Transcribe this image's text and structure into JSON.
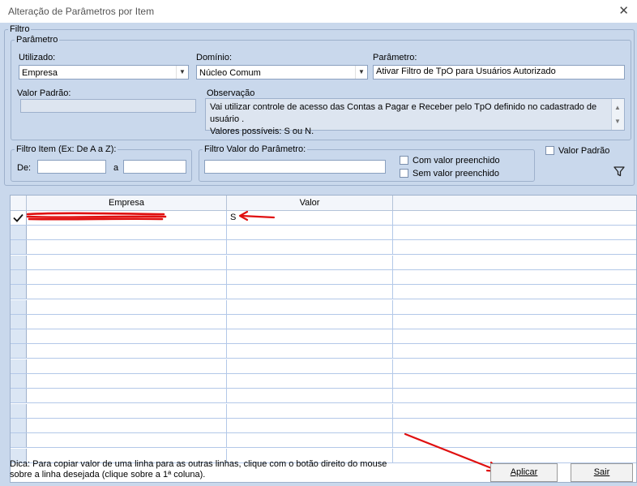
{
  "window": {
    "title": "Alteração de Parâmetros por Item"
  },
  "filtro": {
    "legend": "Filtro",
    "parametro_group": {
      "legend": "Parâmetro",
      "utilizado_label": "Utilizado:",
      "utilizado_value": "Empresa",
      "dominio_label": "Domínio:",
      "dominio_value": "Núcleo Comum",
      "parametro_label": "Parâmetro:",
      "parametro_value": "Ativar Filtro de TpO para Usuários Autorizado",
      "valor_padrao_label": "Valor Padrão:",
      "valor_padrao_value": "",
      "observacao_label": "Observação",
      "observacao_line1": "Vai utilizar controle de acesso das Contas a Pagar e Receber pelo TpO definido no cadastrado de usuário .",
      "observacao_line2": "Valores possíveis: S ou N."
    },
    "filtro_item": {
      "legend": "Filtro Item (Ex: De A a Z):",
      "de_label": "De:",
      "a_label": "a",
      "de_value": "",
      "a_value": ""
    },
    "filtro_valor": {
      "legend": "Filtro Valor do Parâmetro:",
      "value": "",
      "com_valor_label": "Com valor preenchido",
      "sem_valor_label": "Sem valor preenchido"
    },
    "valor_padrao_checkbox_label": "Valor Padrão",
    "filter_icon": "funnel-icon"
  },
  "grid": {
    "columns": [
      "Empresa",
      "Valor"
    ],
    "rows": [
      {
        "selected": true,
        "empresa": "",
        "valor": "S"
      }
    ],
    "empty_row_count": 16
  },
  "footer": {
    "tip_line1": "Dica: Para copiar valor de uma linha para as outras linhas, clique com o botão direito do mouse",
    "tip_line2": "sobre a linha desejada (clique sobre a 1ª coluna).",
    "aplicar_label": "Aplicar",
    "sair_label": "Sair"
  },
  "colors": {
    "background": "#c9d8ec",
    "annotation": "#e01010"
  }
}
